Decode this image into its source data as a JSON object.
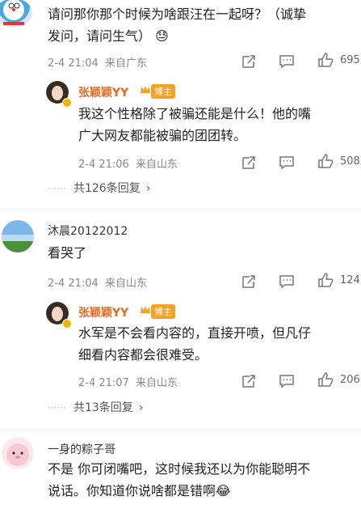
{
  "comments": [
    {
      "text_lines": [
        "请问那你那个时候为啥跟汪在一起呀？（诚挚",
        "发问，请问生气）"
      ],
      "emoji": "😓",
      "time": "2-4 21:04",
      "location": "来自广东",
      "like_count": "695",
      "reply": {
        "author": "张颖颖YY",
        "badge": "博主",
        "text_lines": [
          "我这个性格除了被骗还能是什么！他的嘴",
          "广大网友都能被骗的团团转。"
        ],
        "time": "2-4 21:06",
        "location": "来自山东",
        "like_count": "508"
      },
      "more_replies": "共126条回复"
    },
    {
      "username": "沐晨20122012",
      "text_lines": [
        "看哭了"
      ],
      "time": "2-4 21:04",
      "location": "来自山东",
      "like_count": "124",
      "reply": {
        "author": "张颖颖YY",
        "badge": "博主",
        "text_lines": [
          "水军是不会看内容的，直接开喷，但凡仔",
          "细看内容都会很难受。"
        ],
        "time": "2-4 21:07",
        "location": "来自山东",
        "like_count": "206"
      },
      "more_replies": "共13条回复"
    },
    {
      "username": "一身的粽子哥",
      "text_lines": [
        "不是 你可闭嘴吧，这时候我还以为你能聪明不",
        "说话。你知道你说啥都是错啊"
      ],
      "emoji": "😂"
    }
  ],
  "colors": {
    "author": "#e56a1f",
    "badge_bg": "#f4a12b",
    "meta": "#888888"
  },
  "icons": [
    "share-icon",
    "comment-icon",
    "like-icon",
    "chevron-right-icon"
  ]
}
